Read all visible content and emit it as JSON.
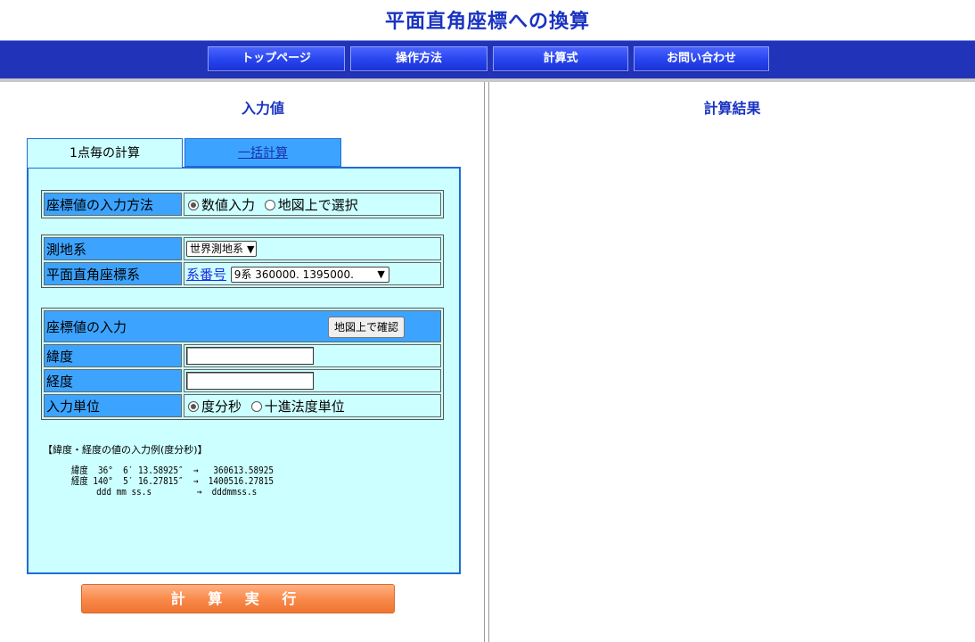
{
  "page": {
    "title": "平面直角座標への換算"
  },
  "nav": {
    "items": [
      {
        "label": "トップページ"
      },
      {
        "label": "操作方法"
      },
      {
        "label": "計算式"
      },
      {
        "label": "お問い合わせ"
      }
    ]
  },
  "input_section": {
    "title": "入力値"
  },
  "result_section": {
    "title": "計算結果"
  },
  "tabs": [
    {
      "label": "1点毎の計算",
      "active": true
    },
    {
      "label": "一括計算",
      "active": false
    }
  ],
  "form": {
    "input_method": {
      "label": "座標値の入力方法",
      "options": [
        {
          "label": "数値入力",
          "selected": true
        },
        {
          "label": "地図上で選択",
          "selected": false
        }
      ]
    },
    "datum": {
      "label": "測地系",
      "selected": "世界測地系"
    },
    "plane_system": {
      "label": "平面直角座標系",
      "link": "系番号",
      "selected": "9系 360000. 1395000."
    },
    "coord_input": {
      "label": "座標値の入力",
      "map_button": "地図上で確認"
    },
    "latitude": {
      "label": "緯度",
      "value": ""
    },
    "longitude": {
      "label": "経度",
      "value": ""
    },
    "unit": {
      "label": "入力単位",
      "options": [
        {
          "label": "度分秒",
          "selected": true
        },
        {
          "label": "十進法度単位",
          "selected": false
        }
      ]
    }
  },
  "example": {
    "title": "【緯度・経度の値の入力例(度分秒)】",
    "lines": [
      "緯度  36°  6′ 13.58925″  →   360613.58925",
      "経度 140°  5′ 16.27815″  →  1400516.27815",
      "     ddd mm ss.s         →  dddmmss.s"
    ]
  },
  "calc_button": {
    "label": "計 算 実 行"
  },
  "colors": {
    "title_blue": "#1a33c2",
    "navbar": "#2133b8",
    "panel_bg": "#ccffff",
    "label_bg": "#3ca4ff",
    "calc_button": "#f98b4c"
  }
}
